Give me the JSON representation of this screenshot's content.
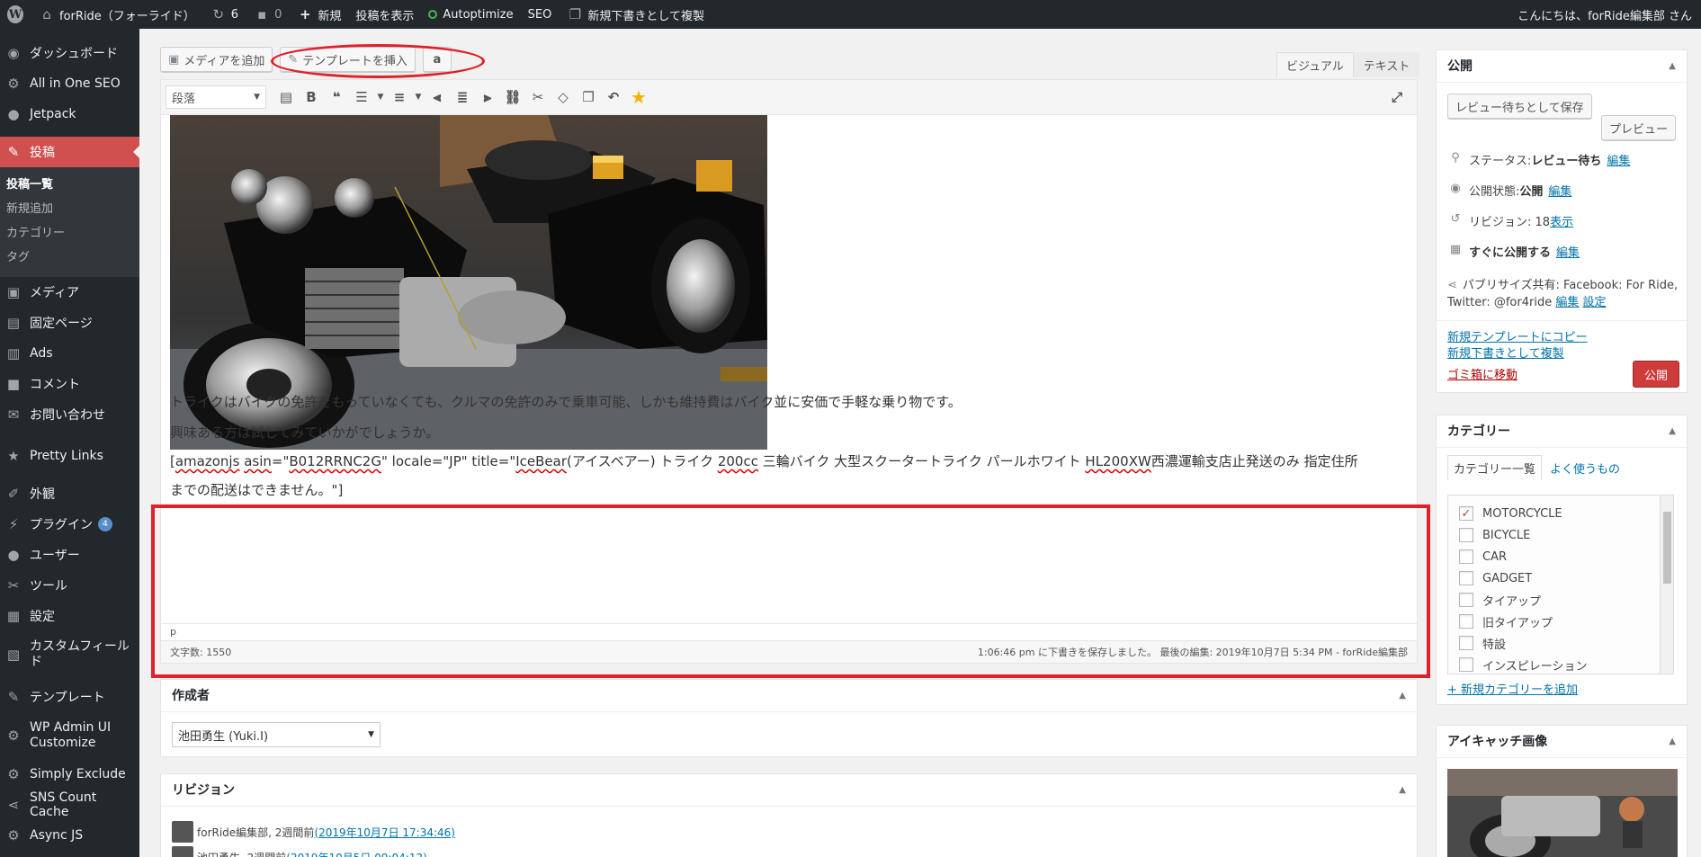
{
  "adminbar": {
    "site_name": "forRide（フォーライド）",
    "updates_count": "6",
    "comments_count": "0",
    "new_label": "新規",
    "view_post": "投稿を表示",
    "autoptimize": "Autoptimize",
    "seo": "SEO",
    "copy_draft": "新規下書きとして複製",
    "greeting": "こんにちは、forRide編集部 さん"
  },
  "sidebar": {
    "items": [
      {
        "label": "ダッシュボード",
        "icon": "dashboard-icon"
      },
      {
        "label": "All in One SEO",
        "icon": "gear-icon"
      },
      {
        "label": "Jetpack",
        "icon": "jetpack-icon"
      },
      {
        "label": "投稿",
        "icon": "pin-icon"
      },
      {
        "label": "メディア",
        "icon": "media-icon"
      },
      {
        "label": "固定ページ",
        "icon": "page-icon"
      },
      {
        "label": "Ads",
        "icon": "chart-icon"
      },
      {
        "label": "コメント",
        "icon": "comment-icon"
      },
      {
        "label": "お問い合わせ",
        "icon": "mail-icon"
      },
      {
        "label": "Pretty Links",
        "icon": "star-icon"
      },
      {
        "label": "外観",
        "icon": "brush-icon"
      },
      {
        "label": "プラグイン",
        "icon": "plugin-icon",
        "badge": "4"
      },
      {
        "label": "ユーザー",
        "icon": "user-icon"
      },
      {
        "label": "ツール",
        "icon": "wrench-icon"
      },
      {
        "label": "設定",
        "icon": "settings-icon"
      },
      {
        "label": "カスタムフィールド",
        "icon": "table-icon"
      },
      {
        "label": "テンプレート",
        "icon": "pencil-icon"
      },
      {
        "label": "WP Admin UI Customize",
        "icon": "gear-icon"
      },
      {
        "label": "Simply Exclude",
        "icon": "gear-icon"
      },
      {
        "label": "SNS Count Cache",
        "icon": "share-icon"
      },
      {
        "label": "Async JS",
        "icon": "gear-icon"
      }
    ],
    "submenu": [
      "投稿一覧",
      "新規追加",
      "カテゴリー",
      "タグ"
    ]
  },
  "editor": {
    "add_media": "メディアを追加",
    "insert_template": "テンプレートを挿入",
    "amazon_btn": "a",
    "tab_visual": "ビジュアル",
    "tab_text": "テキスト",
    "format": "段落",
    "para1": "トライクはバイクの免許をもっていなくても、クルマの免許のみで乗車可能、しかも維持費はバイク並に安価で手軽な乗り物です。",
    "para2": "興味ある方は試してみていかがでしょうか。",
    "shortcode": {
      "s1": "[",
      "s2": "amazonjs",
      "s3": " ",
      "s4": "asin",
      "s5": "=\"",
      "s6": "B012RRNC2G",
      "s7": "\" locale=\"JP\" title=\"",
      "s8": "IceBear",
      "s9": "(アイスベアー) トライク ",
      "s10": "200cc",
      "s11": " 三輪バイク 大型スクータートライク パールホワイト ",
      "s12": "HL200XW",
      "s13": "西濃運輸支店止発送のみ 指定住所",
      "line2": "までの配送はできません。\"]"
    },
    "path": "p",
    "word_count": "文字数: 1550",
    "saved": "1:06:46 pm に下書きを保存しました。 最後の編集: 2019年10月7日 5:34 PM - forRide編集部"
  },
  "author": {
    "title": "作成者",
    "value": "池田勇生 (Yuki.I)"
  },
  "revisions": {
    "title": "リビジョン",
    "rows": [
      {
        "who": "forRide編集部, 2週間前 ",
        "date": "(2019年10月7日 17:34:46)"
      },
      {
        "who": "池田勇生, 2週間前 ",
        "date": "(2019年10月5日 09:04:12)"
      }
    ]
  },
  "publish": {
    "title": "公開",
    "save_review": "レビュー待ちとして保存",
    "preview": "プレビュー",
    "status_label": "ステータス: ",
    "status_value": "レビュー待ち",
    "edit": "編集",
    "visibility_label": "公開状態: ",
    "visibility_value": "公開",
    "revisions_label": "リビジョン: 18 ",
    "revisions_view": "表示",
    "schedule": "すぐに公開する",
    "publicize_1": "パブリサイズ共有: Facebook: For Ride,",
    "publicize_2": "Twitter: @for4ride ",
    "publicize_settings": "設定",
    "copy_template": "新規テンプレートにコピー",
    "copy_draft": "新規下書きとして複製",
    "trash": "ゴミ箱に移動",
    "publish_btn": "公開"
  },
  "categories": {
    "title": "カテゴリー",
    "tab_all": "カテゴリー一覧",
    "tab_popular": "よく使うもの",
    "items": [
      {
        "label": "MOTORCYCLE",
        "checked": "✓"
      },
      {
        "label": "BICYCLE",
        "checked": ""
      },
      {
        "label": "CAR",
        "checked": ""
      },
      {
        "label": "GADGET",
        "checked": ""
      },
      {
        "label": "タイアップ",
        "checked": ""
      },
      {
        "label": "旧タイアップ",
        "checked": ""
      },
      {
        "label": "特設",
        "checked": ""
      },
      {
        "label": "インスピレーション",
        "checked": ""
      }
    ],
    "add_new": "+ 新規カテゴリーを追加"
  },
  "featured": {
    "title": "アイキャッチ画像"
  },
  "colors": {
    "accent": "#d05050",
    "annotation": "#e0202a",
    "link": "#0073aa"
  }
}
